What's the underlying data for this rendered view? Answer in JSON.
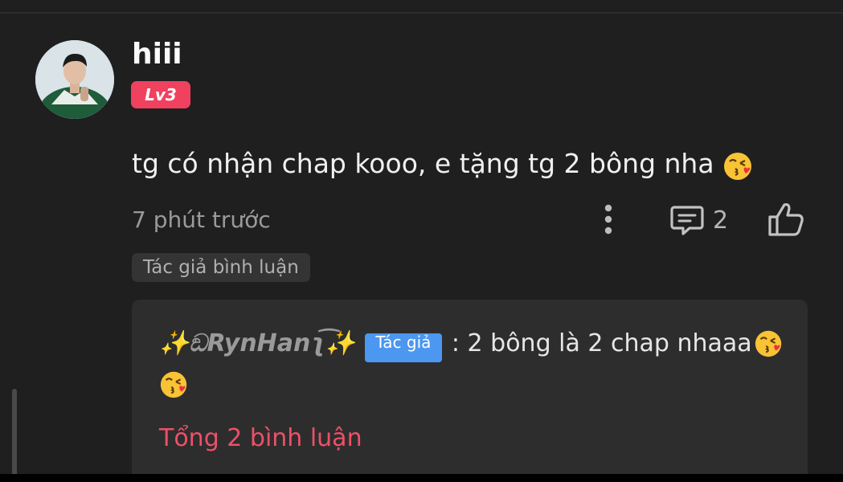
{
  "comment": {
    "username": "hiii",
    "level_badge": "Lv3",
    "text": "tg có nhận chap kooo, e tặng tg 2 bông nha",
    "text_emoji": "face-blowing-kiss",
    "timestamp": "7 phút trước",
    "reply_count": "2",
    "author_commented_tag": "Tác giả bình luận"
  },
  "reply": {
    "author": "✨ඞRynHanʅ͡✨",
    "author_badge": "Tác giả",
    "text": ": 2 bông là 2 chap nhaaa",
    "emoji": "face-blowing-kiss",
    "total_label": "Tổng 2 bình luận"
  },
  "colors": {
    "background": "#1f1f1f",
    "level_badge": "#f0415f",
    "author_badge": "#4c97f0",
    "total_link": "#ee5068",
    "reply_box": "#2d2d2d"
  }
}
